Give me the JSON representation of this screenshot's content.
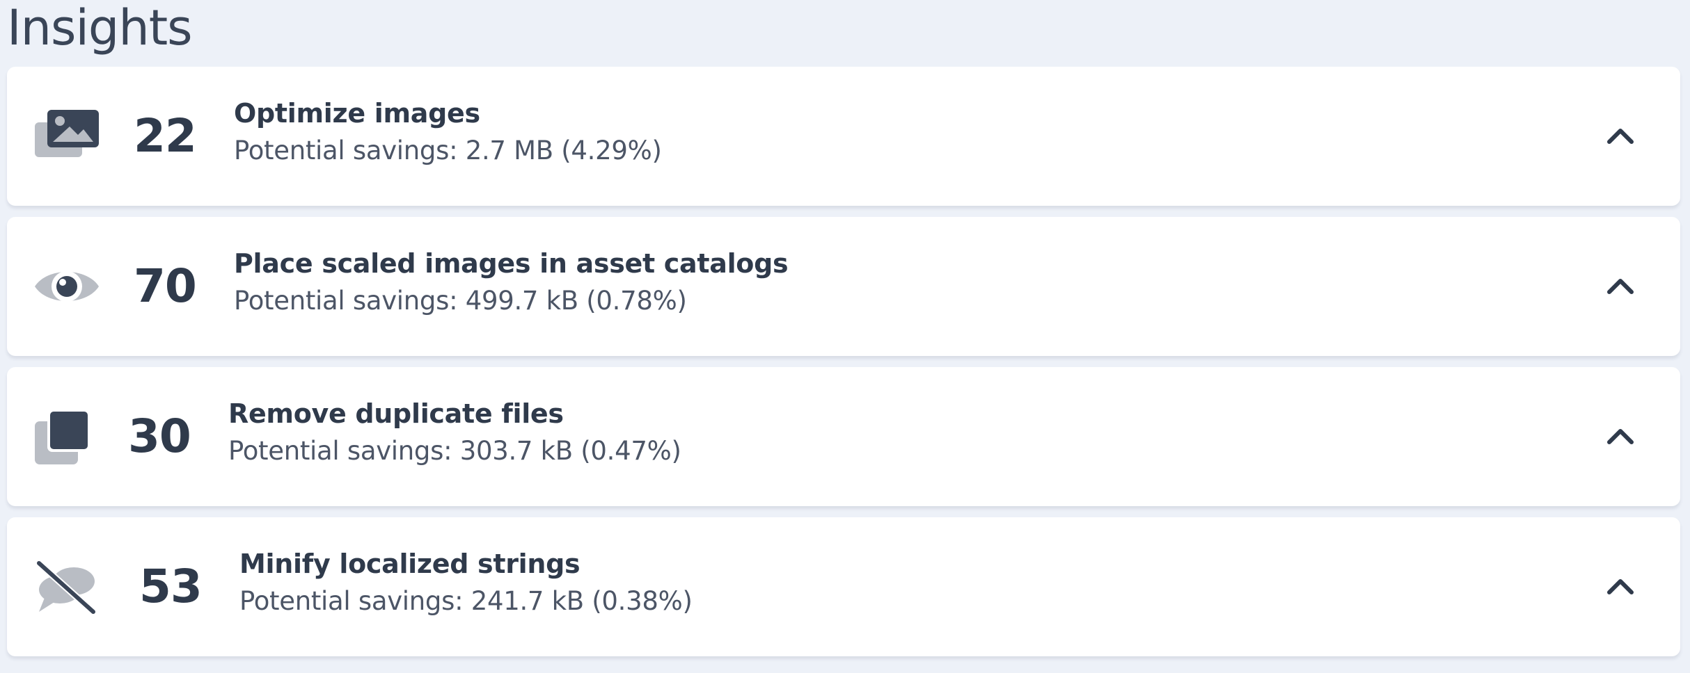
{
  "page": {
    "title": "Insights"
  },
  "colors": {
    "background": "#edf1f8",
    "card": "#ffffff",
    "text": "#2f3a4b",
    "muted_text": "#4c5566",
    "icon_dark": "#3a4557",
    "icon_light": "#b9bdc4"
  },
  "insights": [
    {
      "icon": "images-icon",
      "count": "22",
      "title": "Optimize images",
      "subtitle": "Potential savings: 2.7 MB (4.29%)",
      "toggle_icon": "chevron-up-icon"
    },
    {
      "icon": "eye-icon",
      "count": "70",
      "title": "Place scaled images in asset catalogs",
      "subtitle": "Potential savings: 499.7 kB (0.78%)",
      "toggle_icon": "chevron-up-icon"
    },
    {
      "icon": "duplicate-files-icon",
      "count": "30",
      "title": "Remove duplicate files",
      "subtitle": "Potential savings: 303.7 kB (0.47%)",
      "toggle_icon": "chevron-up-icon"
    },
    {
      "icon": "comments-slash-icon",
      "count": "53",
      "title": "Minify localized strings",
      "subtitle": "Potential savings: 241.7 kB (0.38%)",
      "toggle_icon": "chevron-up-icon"
    }
  ]
}
